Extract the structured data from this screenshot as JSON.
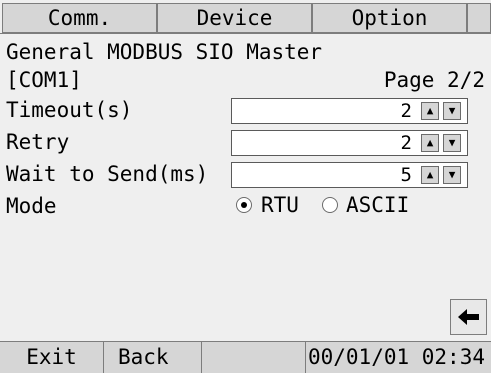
{
  "tabs": [
    {
      "label": "Comm."
    },
    {
      "label": "Device"
    },
    {
      "label": "Option"
    },
    {
      "label": ""
    }
  ],
  "header": {
    "title": "General MODBUS SIO Master",
    "port": "[COM1]",
    "page": "Page 2/2"
  },
  "settings": {
    "timeout": {
      "label": "Timeout(s)",
      "value": "2"
    },
    "retry": {
      "label": "Retry",
      "value": "2"
    },
    "wait": {
      "label": "Wait to Send(ms)",
      "value": "5"
    },
    "mode": {
      "label": "Mode",
      "options": [
        "RTU",
        "ASCII"
      ],
      "selected": "RTU"
    }
  },
  "icons": {
    "spin_up": "up-triangle-icon",
    "spin_down": "down-triangle-icon",
    "back": "left-arrow-icon",
    "spin_up_glyph": "▲",
    "spin_down_glyph": "▼"
  },
  "footer": {
    "exit_label": "Exit",
    "back_label": "Back",
    "datetime": "00/01/01 02:34"
  },
  "colors": {
    "background": "#efefef",
    "tab_inactive": "#d6d6d6",
    "field_bg": "#ffffff"
  }
}
